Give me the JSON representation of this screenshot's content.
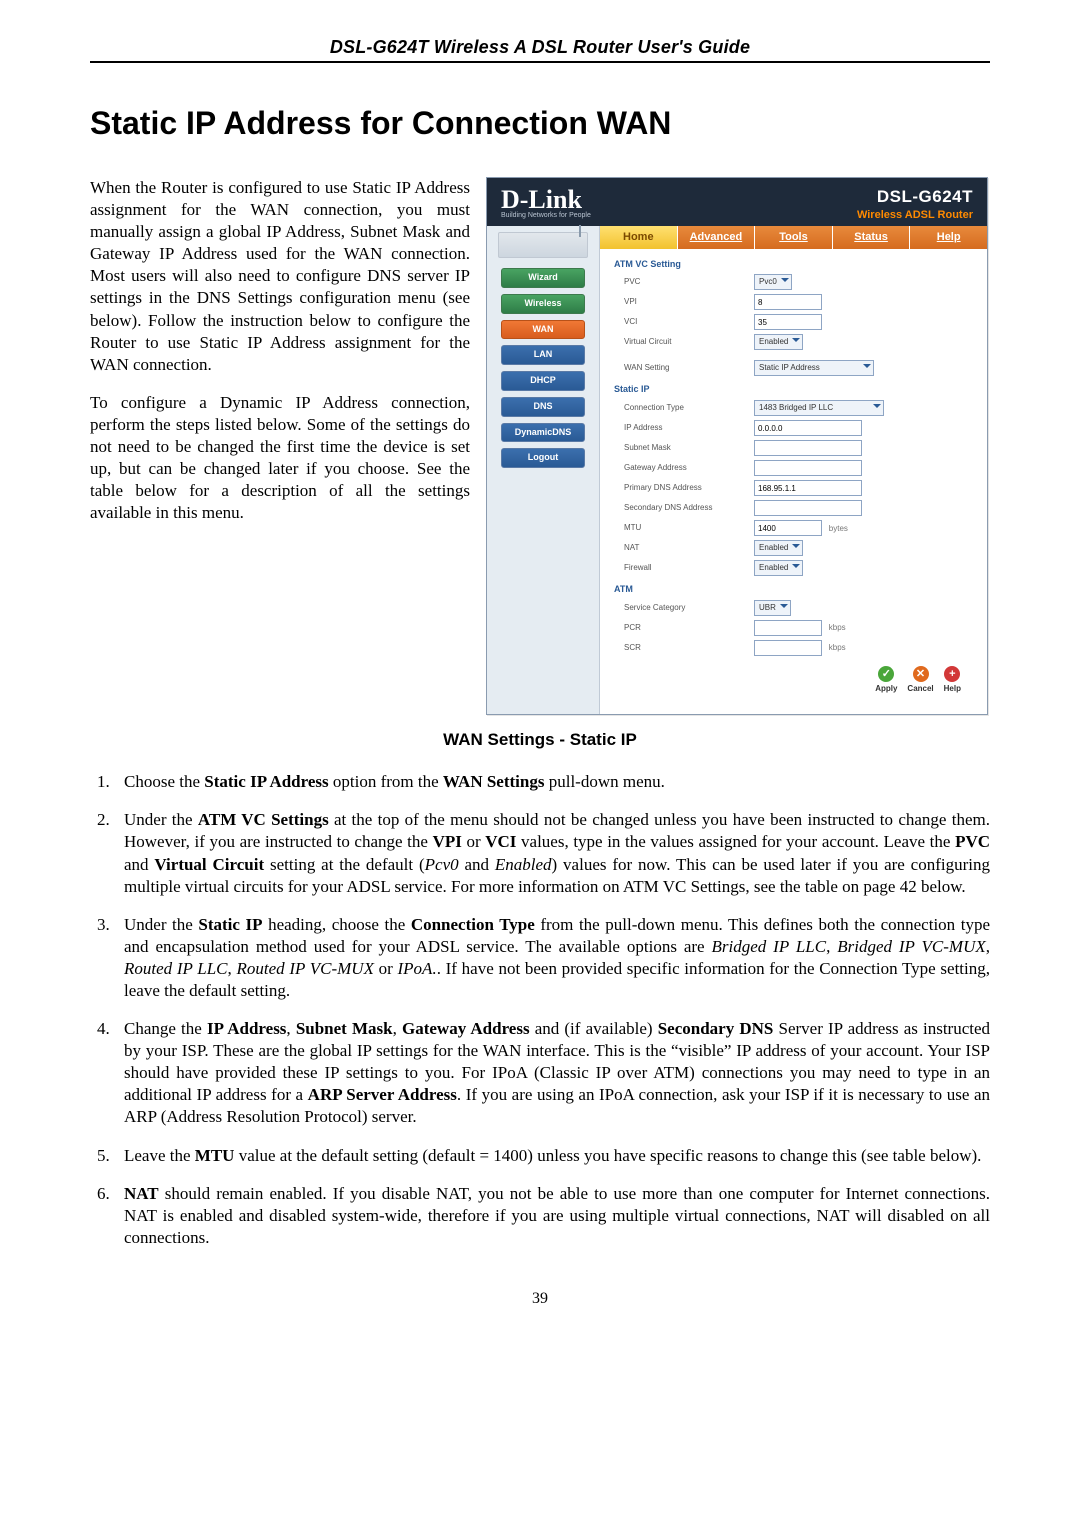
{
  "header": "DSL-G624T Wireless A DSL Router User's Guide",
  "title": "Static IP Address for Connection WAN",
  "intro": [
    "When the Router is configured to use Static IP Address assignment for the WAN connection, you must manually assign a global IP Address, Subnet Mask and Gateway IP Address used for the WAN connection. Most users will also need to configure DNS server IP settings in the DNS Settings configuration menu (see below). Follow the instruction below to configure the Router to use Static IP Address assignment for the WAN connection.",
    "To configure a Dynamic IP Address connection, perform the steps listed below. Some of the settings do not need to be changed the first time the device is set up, but can be changed later if you choose. See the table below for a description of all the settings available in this menu."
  ],
  "router": {
    "brand": "D-Link",
    "tagline": "Building Networks for People",
    "model": "DSL-G624T",
    "model_sub": "Wireless ADSL Router",
    "tabs": [
      "Home",
      "Advanced",
      "Tools",
      "Status",
      "Help"
    ],
    "active_tab": 0,
    "side_buttons": [
      "Wizard",
      "Wireless",
      "WAN",
      "LAN",
      "DHCP",
      "DNS",
      "DynamicDNS",
      "Logout"
    ],
    "side_active": 2,
    "sections": {
      "atm_vc": {
        "title": "ATM VC Setting",
        "pvc_label": "PVC",
        "pvc_value": "Pvc0",
        "vpi_label": "VPI",
        "vpi_value": "8",
        "vci_label": "VCI",
        "vci_value": "35",
        "vcircuit_label": "Virtual Circuit",
        "vcircuit_value": "Enabled",
        "wan_setting_label": "WAN Setting",
        "wan_setting_value": "Static IP Address"
      },
      "static_ip": {
        "title": "Static IP",
        "conn_type_label": "Connection Type",
        "conn_type_value": "1483 Bridged IP LLC",
        "ip_label": "IP Address",
        "ip_value": "0.0.0.0",
        "subnet_label": "Subnet Mask",
        "subnet_value": "",
        "gateway_label": "Gateway Address",
        "gateway_value": "",
        "pdns_label": "Primary DNS Address",
        "pdns_value": "168.95.1.1",
        "sdns_label": "Secondary DNS Address",
        "sdns_value": "",
        "mtu_label": "MTU",
        "mtu_value": "1400",
        "mtu_unit": "bytes",
        "nat_label": "NAT",
        "nat_value": "Enabled",
        "firewall_label": "Firewall",
        "firewall_value": "Enabled"
      },
      "atm": {
        "title": "ATM",
        "svc_cat_label": "Service Category",
        "svc_cat_value": "UBR",
        "pcr_label": "PCR",
        "pcr_value": "",
        "pcr_unit": "kbps",
        "scr_label": "SCR",
        "scr_value": "",
        "scr_unit": "kbps"
      }
    },
    "actions": {
      "apply": "Apply",
      "cancel": "Cancel",
      "help": "Help"
    }
  },
  "caption": "WAN Settings - Static IP",
  "steps": {
    "s1": {
      "a": "Choose the ",
      "b": "Static IP Address",
      "c": " option from the ",
      "d": "WAN Settings",
      "e": " pull-down menu."
    },
    "s2": {
      "a": "Under the ",
      "b": "ATM VC Settings",
      "c": " at the top of the menu should not be changed unless you have been instructed to change them. However, if you are instructed to change the ",
      "d": "VPI",
      "e": " or ",
      "f": "VCI",
      "g": " values, type in the values assigned for your account. Leave the ",
      "h": "PVC",
      "i": " and ",
      "j": "Virtual Circuit",
      "k": " setting at the default (",
      "l": "Pcv0",
      "m": " and ",
      "n": "Enabled",
      "o": ") values for now. This can be used later if you are configuring multiple virtual circuits for your ADSL service. For more information on ATM VC Settings, see the table on page 42 below."
    },
    "s3": {
      "a": "Under the ",
      "b": "Static IP",
      "c": " heading, choose the ",
      "d": "Connection Type",
      "e": " from the pull-down menu. This defines both the connection type and encapsulation method used for your ADSL service. The available options are ",
      "f": "Bridged IP LLC",
      "g": ", ",
      "h": "Bridged IP VC-MUX",
      "i": ", ",
      "j": "Routed IP LLC",
      "k": ", ",
      "l": "Routed IP VC-MUX",
      "m": " or ",
      "n": "IPoA.",
      "o": ". If have not been provided specific information for the Connection Type setting, leave the default setting."
    },
    "s4": {
      "a": "Change the ",
      "b": "IP Address",
      "c": ", ",
      "d": "Subnet Mask",
      "e": ", ",
      "f": "Gateway Address",
      "g": " and (if available) ",
      "h": "Secondary DNS",
      "i": " Server IP address as instructed by your ISP. These are the global IP settings for the WAN interface. This is the “visible” IP address of your account. Your ISP should have provided these IP settings to you. For IPoA (Classic IP over ATM) connections you may need to type in an additional IP address for a ",
      "j": "ARP Server Address",
      "k": ".  If you are using an IPoA connection, ask your ISP if it is necessary to use an ARP (Address Resolution Protocol) server."
    },
    "s5": {
      "a": "Leave the ",
      "b": "MTU",
      "c": " value at the default setting (default = 1400) unless you have specific reasons to change this (see table below)."
    },
    "s6": {
      "a": "NAT",
      "b": " should remain enabled. If you disable NAT, you not be able to use more than one computer for Internet connections. NAT is enabled and disabled system-wide, therefore if you are using multiple virtual connections, NAT will disabled on all connections."
    }
  },
  "page_number": "39"
}
